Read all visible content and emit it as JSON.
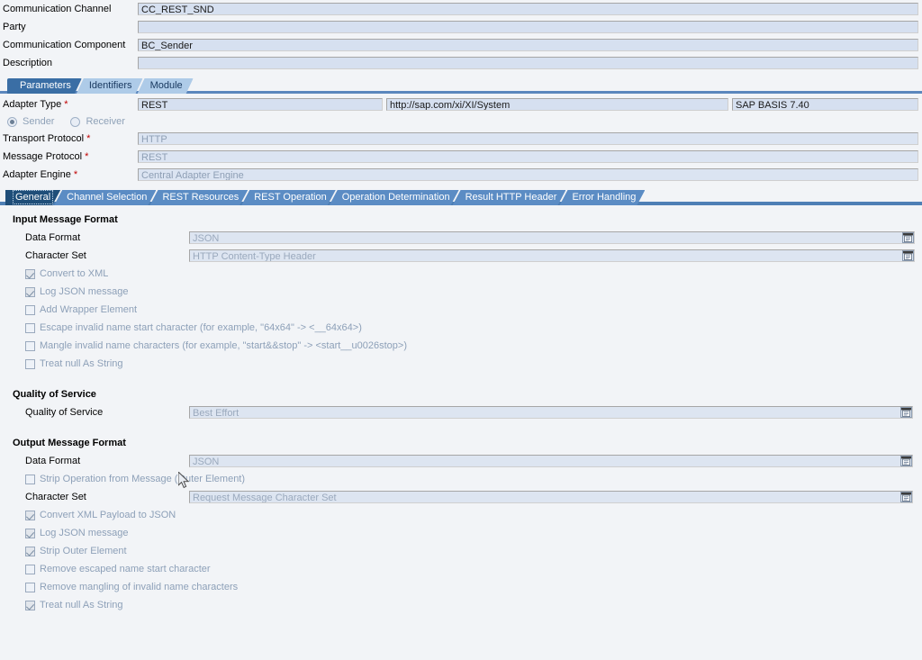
{
  "header": {
    "rows": [
      {
        "label": "Communication Channel",
        "value": "CC_REST_SND",
        "readonly": false
      },
      {
        "label": "Party",
        "value": "",
        "readonly": false
      },
      {
        "label": "Communication Component",
        "value": "BC_Sender",
        "readonly": false
      },
      {
        "label": "Description",
        "value": "",
        "readonly": false
      }
    ]
  },
  "main_tabs": [
    {
      "label": "Parameters",
      "active": true
    },
    {
      "label": "Identifiers",
      "active": false
    },
    {
      "label": "Module",
      "active": false
    }
  ],
  "adapter": {
    "type_label": "Adapter Type",
    "type_value": "REST",
    "namespace_value": "http://sap.com/xi/XI/System",
    "swcv_value": "SAP BASIS 7.40",
    "direction": {
      "sender_label": "Sender",
      "receiver_label": "Receiver",
      "selected": "Sender"
    },
    "transport_protocol_label": "Transport Protocol",
    "transport_protocol_value": "HTTP",
    "message_protocol_label": "Message Protocol",
    "message_protocol_value": "REST",
    "adapter_engine_label": "Adapter Engine",
    "adapter_engine_value": "Central Adapter Engine",
    "required_marker": "*"
  },
  "sub_tabs": [
    {
      "label": "General",
      "active": true
    },
    {
      "label": "Channel Selection",
      "active": false
    },
    {
      "label": "REST Resources",
      "active": false
    },
    {
      "label": "REST Operation",
      "active": false
    },
    {
      "label": "Operation Determination",
      "active": false
    },
    {
      "label": "Result HTTP Header",
      "active": false
    },
    {
      "label": "Error Handling",
      "active": false
    }
  ],
  "input_message_format": {
    "title": "Input Message Format",
    "data_format_label": "Data Format",
    "data_format_value": "JSON",
    "character_set_label": "Character Set",
    "character_set_value": "HTTP Content-Type Header",
    "checkboxes": [
      {
        "label": "Convert to XML",
        "checked": true
      },
      {
        "label": "Log JSON message",
        "checked": true
      },
      {
        "label": "Add Wrapper Element",
        "checked": false
      },
      {
        "label": "Escape invalid name start character (for example, \"64x64\" -> <__64x64>)",
        "checked": false
      },
      {
        "label": "Mangle invalid name characters (for example, \"start&&stop\" -> <start__u0026stop>)",
        "checked": false
      },
      {
        "label": "Treat null As String",
        "checked": false
      }
    ]
  },
  "quality_of_service": {
    "title": "Quality of Service",
    "label": "Quality of Service",
    "value": "Best Effort"
  },
  "output_message_format": {
    "title": "Output Message Format",
    "data_format_label": "Data Format",
    "data_format_value": "JSON",
    "strip_operation": {
      "label": "Strip Operation from Message (Outer Element)",
      "checked": false
    },
    "character_set_label": "Character Set",
    "character_set_value": "Request Message Character Set",
    "checkboxes": [
      {
        "label": "Convert XML Payload to JSON",
        "checked": true
      },
      {
        "label": "Log JSON message",
        "checked": true
      },
      {
        "label": "Strip Outer Element",
        "checked": true
      },
      {
        "label": "Remove escaped name start character",
        "checked": false
      },
      {
        "label": "Remove mangling of invalid name characters",
        "checked": false
      },
      {
        "label": "Treat null As String",
        "checked": true
      }
    ]
  },
  "icons": {
    "value_help": "value-help-icon",
    "cursor": "mouse-pointer-icon"
  },
  "colors": {
    "page_background": "#f2f4f7",
    "field_background": "#d6e0f0",
    "field_readonly_text": "#8e9fb5",
    "tab_active": "#1f4e79",
    "tab_inactive": "#5b8cc4",
    "main_tab_active": "#3a6ea5",
    "main_tab_inactive": "#aecbe8",
    "required_marker": "#c00000"
  }
}
